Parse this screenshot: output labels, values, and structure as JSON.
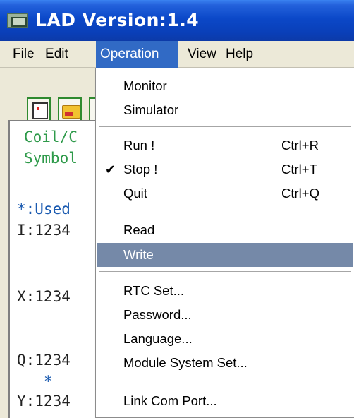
{
  "window": {
    "title": "LAD Version:1.4"
  },
  "menubar": {
    "items": [
      {
        "label": "File",
        "accel": "F",
        "rest": "ile"
      },
      {
        "label": "Edit",
        "accel": "E",
        "rest": "dit"
      },
      {
        "label": "Operation",
        "accel": "O",
        "rest": "peration"
      },
      {
        "label": "View",
        "accel": "V",
        "rest": "iew"
      },
      {
        "label": "Help",
        "accel": "H",
        "rest": "elp"
      }
    ]
  },
  "editor": {
    "lines": [
      "Coil/C",
      "Symbol",
      "*:Used",
      "I:1234",
      "X:1234",
      "Q:1234",
      "*",
      "Y:1234"
    ]
  },
  "operation_menu": {
    "items": [
      {
        "label": "Monitor",
        "shortcut": ""
      },
      {
        "label": "Simulator",
        "shortcut": ""
      },
      {
        "label": "Run !",
        "shortcut": "Ctrl+R"
      },
      {
        "label": "Stop !",
        "shortcut": "Ctrl+T",
        "checked": true
      },
      {
        "label": "Quit",
        "shortcut": "Ctrl+Q"
      },
      {
        "label": "Read",
        "shortcut": ""
      },
      {
        "label": "Write",
        "shortcut": "",
        "highlighted": true
      },
      {
        "label": "RTC Set...",
        "shortcut": ""
      },
      {
        "label": "Password...",
        "shortcut": ""
      },
      {
        "label": "Language...",
        "shortcut": ""
      },
      {
        "label": "Module System Set...",
        "shortcut": ""
      },
      {
        "label": "Link Com Port...",
        "shortcut": ""
      }
    ],
    "check_mark": "✔"
  },
  "colors": {
    "titlebar": "#0a3fb8",
    "menu_active": "#316ac5",
    "menu_highlight": "#7589a8",
    "code_green": "#2e9a4a"
  }
}
